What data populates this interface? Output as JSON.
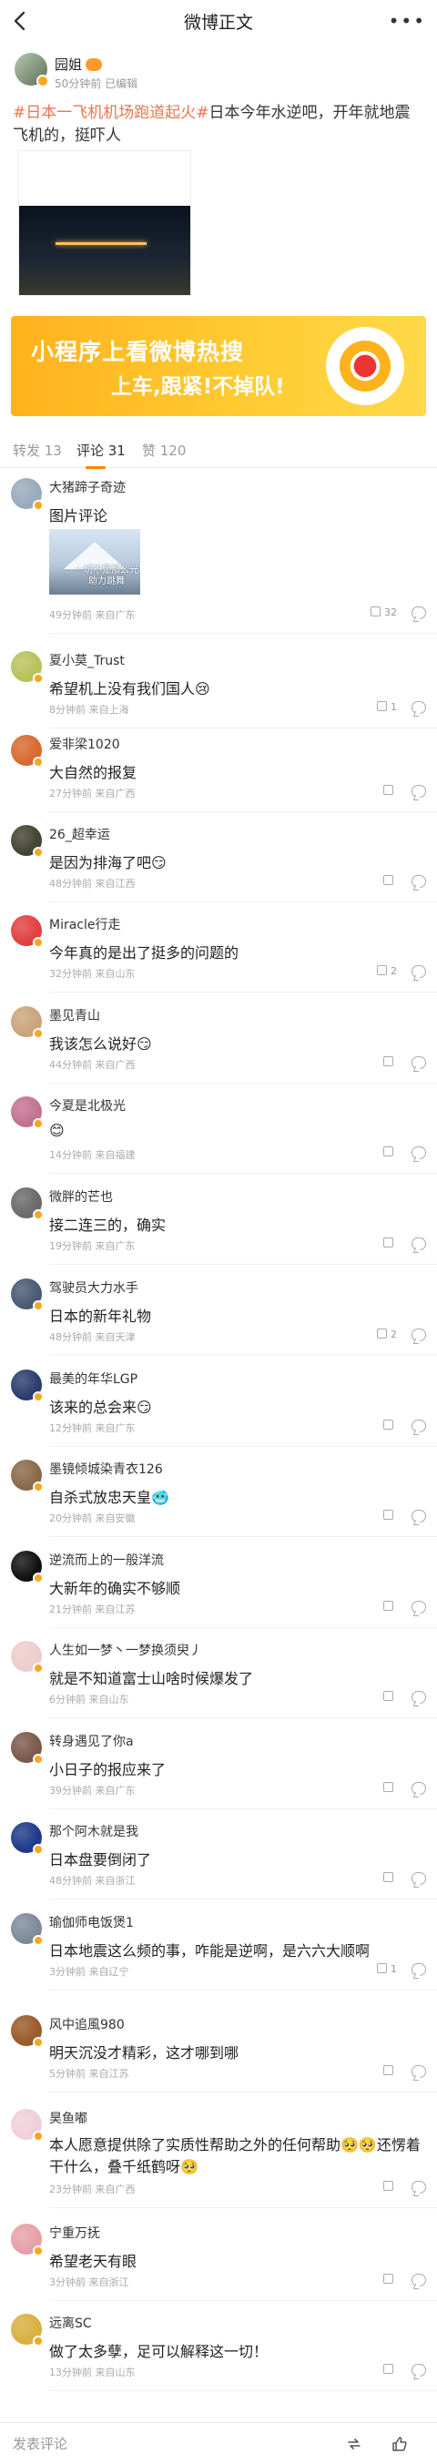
{
  "header": {
    "title": "微博正文"
  },
  "post": {
    "author": "园姐",
    "meta": "50分钟前  已编辑",
    "topic": "#日本一飞机机场跑道起火#",
    "text": "日本今年水逆吧，开年就地震飞机的，挺吓人"
  },
  "banner": {
    "line1": "小程序上看微博热搜",
    "line2": "上车,跟紧!不掉队!"
  },
  "tabs": [
    {
      "label": "转发 13"
    },
    {
      "label": "评论 31"
    },
    {
      "label": "赞 120"
    }
  ],
  "comments": [
    {
      "name": "大猪蹄子奇迹",
      "text": "图片评论",
      "pic_caption": "一切不是那么光\n助力跳舞",
      "meta": "49分钟前 来自广东",
      "likes": "32",
      "avatar_color": "#9ab"
    },
    {
      "name": "夏小莫_Trust",
      "text": "希望机上没有我们国人😢",
      "meta": "8分钟前 来自上海",
      "likes": "1",
      "avatar_color": "#b8c25a"
    },
    {
      "name": "爱非梁1020",
      "text": "大自然的报复",
      "meta": "27分钟前 来自广西",
      "likes": "",
      "avatar_color": "#d9692e"
    },
    {
      "name": "26_超幸运",
      "text": "是因为排海了吧😏",
      "meta": "48分钟前 来自江西",
      "likes": "",
      "avatar_color": "#443"
    },
    {
      "name": "Miracle行走",
      "text": "今年真的是出了挺多的问题的",
      "meta": "32分钟前 来自山东",
      "likes": "2",
      "avatar_color": "#e14040"
    },
    {
      "name": "墨见青山",
      "text": "我该怎么说好😏",
      "meta": "44分钟前 来自广西",
      "likes": "",
      "avatar_color": "#c9a57a"
    },
    {
      "name": "今夏是北极光",
      "text": "😊",
      "meta": "14分钟前 来自福建",
      "likes": "",
      "avatar_color": "#c2738f"
    },
    {
      "name": "微胖的芒也",
      "text": "接二连三的，确实",
      "meta": "19分钟前 来自广东",
      "likes": "",
      "avatar_color": "#6a6a6a"
    },
    {
      "name": "驾驶员大力水手",
      "text": "日本的新年礼物",
      "meta": "48分钟前 来自天津",
      "likes": "2",
      "avatar_color": "#4a5a72"
    },
    {
      "name": "最美的年华LGP",
      "text": "该来的总会来😏",
      "meta": "12分钟前 来自广东",
      "likes": "",
      "avatar_color": "#2b3d6e"
    },
    {
      "name": "墨镜倾城染青衣126",
      "text": "自杀式放忠天皇🥶",
      "meta": "20分钟前 来自安徽",
      "likes": "",
      "avatar_color": "#8a6a4a"
    },
    {
      "name": "逆流而上的一般洋流",
      "text": "大新年的确实不够顺",
      "meta": "21分钟前 来自江苏",
      "likes": "",
      "avatar_color": "#111"
    },
    {
      "name": "人生如一梦丶一梦换须臾丿",
      "text": "就是不知道富士山啥时候爆发了",
      "meta": "6分钟前 来自山东",
      "likes": "",
      "avatar_color": "#ecc"
    },
    {
      "name": "转身遇见了你a",
      "text": "小日子的报应来了",
      "meta": "39分钟前 来自广东",
      "likes": "",
      "avatar_color": "#7a5a4a"
    },
    {
      "name": "那个阿木就是我",
      "text": "日本盘要倒闭了",
      "meta": "48分钟前 来自浙江",
      "likes": "",
      "avatar_color": "#1e3a8a"
    },
    {
      "name": "瑜伽师电饭煲1",
      "text": "日本地震这么频的事，咋能是逆啊，是六六大顺啊",
      "meta": "3分钟前 来自辽宁",
      "likes": "1",
      "avatar_color": "#7d8a9a"
    },
    {
      "name": "风中追風980",
      "text": "明天沉没才精彩，这才哪到哪",
      "meta": "5分钟前 来自江苏",
      "likes": "",
      "avatar_color": "#9a5a2a"
    },
    {
      "name": "昊鱼嘟",
      "text": "本人愿意提供除了实质性帮助之外的任何帮助🥺🥺还愣着干什么，叠千纸鹤呀🥺",
      "meta": "23分钟前 来自广西",
      "likes": "",
      "avatar_color": "#f0d0d8"
    },
    {
      "name": "宁重万抚",
      "text": "希望老天有眼",
      "meta": "3分钟前 来自浙江",
      "likes": "",
      "avatar_color": "#e6a0a8"
    },
    {
      "name": "远离SC",
      "text": "做了太多孽，足可以解释这一切！",
      "meta": "13分钟前 来自山东",
      "likes": "",
      "avatar_color": "#d8b040"
    }
  ],
  "bottombar": {
    "placeholder": "发表评论"
  },
  "colors": {
    "accent": "#ff8200",
    "topic": "#eb7350",
    "banner": "#ffc12a"
  }
}
